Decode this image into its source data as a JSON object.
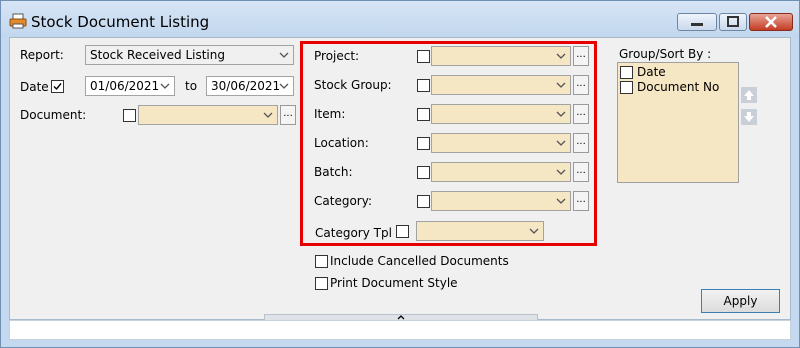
{
  "window": {
    "title": "Stock Document Listing"
  },
  "icons": {
    "app": "printer-icon",
    "minimize": "minimize-icon",
    "restore": "restore-icon",
    "close": "close-icon",
    "dropdown": "chevron-down-icon",
    "up": "arrow-up-icon",
    "down": "arrow-down-icon",
    "collapse": "chevron-up-icon"
  },
  "left": {
    "report_label": "Report:",
    "report_value": "Stock Received Listing",
    "date_label": "Date",
    "date_from": "01/06/2021",
    "to_label": "to",
    "date_to": "30/06/2021",
    "document_label": "Document:"
  },
  "filters": [
    {
      "label": "Project:"
    },
    {
      "label": "Stock Group:"
    },
    {
      "label": "Item:"
    },
    {
      "label": "Location:"
    },
    {
      "label": "Batch:"
    },
    {
      "label": "Category:"
    }
  ],
  "category_tpl": {
    "label": "Category Tpl :"
  },
  "options": {
    "include_cancelled": "Include Cancelled Documents",
    "print_document_style": "Print Document Style"
  },
  "group_sort": {
    "label": "Group/Sort By :",
    "items": [
      "Date",
      "Document No"
    ]
  },
  "buttons": {
    "apply": "Apply",
    "browse": "..."
  },
  "colors": {
    "highlight": "#e60000",
    "field_bg": "#f5e6c4",
    "title_bg": "#c4d8ef"
  }
}
